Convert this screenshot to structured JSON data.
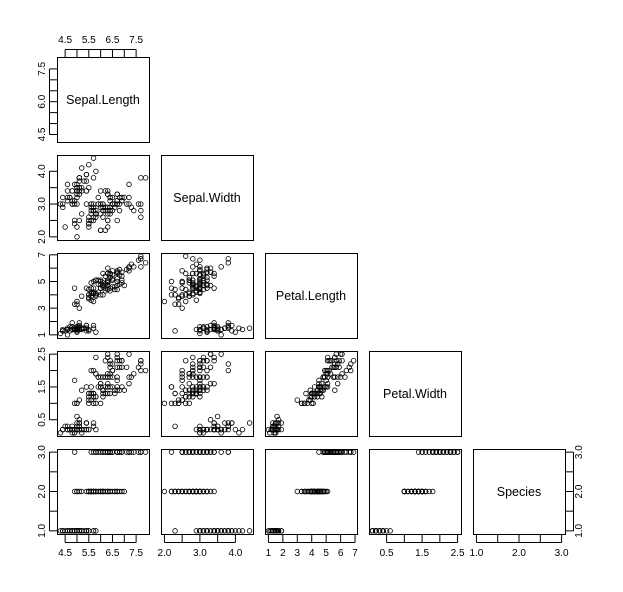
{
  "chart_data": {
    "type": "scatter",
    "title": "",
    "layout": "pairs-lower-triangle",
    "variables": [
      "Sepal.Length",
      "Sepal.Width",
      "Petal.Length",
      "Petal.Width",
      "Species"
    ],
    "ranges": {
      "Sepal.Length": [
        4.3,
        7.9
      ],
      "Sepal.Width": [
        2.0,
        4.4
      ],
      "Petal.Length": [
        1.0,
        6.9
      ],
      "Petal.Width": [
        0.1,
        2.5
      ],
      "Species": [
        1,
        3
      ]
    },
    "ticks": {
      "Sepal.Length": {
        "major": [
          4.5,
          5.0,
          5.5,
          6.0,
          6.5,
          7.0,
          7.5
        ],
        "labels_top": [
          "4.5",
          "5.5",
          "6.5",
          "7.5"
        ],
        "labels_left": [
          "4.5",
          "6.0",
          "7.5"
        ],
        "labels_left_at": [
          4.5,
          6.0,
          7.5
        ],
        "minor_left": [
          4.5,
          5.0,
          5.5,
          6.0,
          6.5,
          7.0,
          7.5
        ]
      },
      "Sepal.Width": {
        "major": [
          2.0,
          2.5,
          3.0,
          3.5,
          4.0
        ],
        "labels": [
          "2.0",
          "3.0",
          "4.0"
        ],
        "labels_at": [
          2.0,
          3.0,
          4.0
        ]
      },
      "Petal.Length": {
        "major": [
          1,
          2,
          3,
          4,
          5,
          6,
          7
        ],
        "labels_bottom": [
          "1",
          "2",
          "3",
          "4",
          "5",
          "6",
          "7"
        ],
        "labels_left": [
          "1",
          "3",
          "5",
          "7"
        ],
        "labels_left_at": [
          1,
          3,
          5,
          7
        ]
      },
      "Petal.Width": {
        "major": [
          0.5,
          1.0,
          1.5,
          2.0,
          2.5
        ],
        "labels": [
          "0.5",
          "1.5",
          "2.5"
        ],
        "labels_at": [
          0.5,
          1.5,
          2.5
        ]
      },
      "Species": {
        "major": [
          1.0,
          1.5,
          2.0,
          2.5,
          3.0
        ],
        "labels": [
          "1.0",
          "2.0",
          "3.0"
        ],
        "labels_at": [
          1.0,
          2.0,
          3.0
        ]
      }
    },
    "marker": "open-circle",
    "columns": [
      "Sepal.Length",
      "Sepal.Width",
      "Petal.Length",
      "Petal.Width",
      "Species"
    ],
    "rows": [
      [
        5.1,
        3.5,
        1.4,
        0.2,
        1
      ],
      [
        4.9,
        3.0,
        1.4,
        0.2,
        1
      ],
      [
        4.7,
        3.2,
        1.3,
        0.2,
        1
      ],
      [
        4.6,
        3.1,
        1.5,
        0.2,
        1
      ],
      [
        5.0,
        3.6,
        1.4,
        0.2,
        1
      ],
      [
        5.4,
        3.9,
        1.7,
        0.4,
        1
      ],
      [
        4.6,
        3.4,
        1.4,
        0.3,
        1
      ],
      [
        5.0,
        3.4,
        1.5,
        0.2,
        1
      ],
      [
        4.4,
        2.9,
        1.4,
        0.2,
        1
      ],
      [
        4.9,
        3.1,
        1.5,
        0.1,
        1
      ],
      [
        5.4,
        3.7,
        1.5,
        0.2,
        1
      ],
      [
        4.8,
        3.4,
        1.6,
        0.2,
        1
      ],
      [
        4.8,
        3.0,
        1.4,
        0.1,
        1
      ],
      [
        4.3,
        3.0,
        1.1,
        0.1,
        1
      ],
      [
        5.8,
        4.0,
        1.2,
        0.2,
        1
      ],
      [
        5.7,
        4.4,
        1.5,
        0.4,
        1
      ],
      [
        5.4,
        3.9,
        1.3,
        0.4,
        1
      ],
      [
        5.1,
        3.5,
        1.4,
        0.3,
        1
      ],
      [
        5.7,
        3.8,
        1.7,
        0.3,
        1
      ],
      [
        5.1,
        3.8,
        1.5,
        0.3,
        1
      ],
      [
        5.4,
        3.4,
        1.7,
        0.2,
        1
      ],
      [
        5.1,
        3.7,
        1.5,
        0.4,
        1
      ],
      [
        4.6,
        3.6,
        1.0,
        0.2,
        1
      ],
      [
        5.1,
        3.3,
        1.7,
        0.5,
        1
      ],
      [
        4.8,
        3.4,
        1.9,
        0.2,
        1
      ],
      [
        5.0,
        3.0,
        1.6,
        0.2,
        1
      ],
      [
        5.0,
        3.4,
        1.6,
        0.4,
        1
      ],
      [
        5.2,
        3.5,
        1.5,
        0.2,
        1
      ],
      [
        5.2,
        3.4,
        1.4,
        0.2,
        1
      ],
      [
        4.7,
        3.2,
        1.6,
        0.2,
        1
      ],
      [
        4.8,
        3.1,
        1.6,
        0.2,
        1
      ],
      [
        5.4,
        3.4,
        1.5,
        0.4,
        1
      ],
      [
        5.2,
        4.1,
        1.5,
        0.1,
        1
      ],
      [
        5.5,
        4.2,
        1.4,
        0.2,
        1
      ],
      [
        4.9,
        3.1,
        1.5,
        0.2,
        1
      ],
      [
        5.0,
        3.2,
        1.2,
        0.2,
        1
      ],
      [
        5.5,
        3.5,
        1.3,
        0.2,
        1
      ],
      [
        4.9,
        3.6,
        1.4,
        0.1,
        1
      ],
      [
        4.4,
        3.0,
        1.3,
        0.2,
        1
      ],
      [
        5.1,
        3.4,
        1.5,
        0.2,
        1
      ],
      [
        5.0,
        3.5,
        1.3,
        0.3,
        1
      ],
      [
        4.5,
        2.3,
        1.3,
        0.3,
        1
      ],
      [
        4.4,
        3.2,
        1.3,
        0.2,
        1
      ],
      [
        5.0,
        3.5,
        1.6,
        0.6,
        1
      ],
      [
        5.1,
        3.8,
        1.9,
        0.4,
        1
      ],
      [
        4.8,
        3.0,
        1.4,
        0.3,
        1
      ],
      [
        5.1,
        3.8,
        1.6,
        0.2,
        1
      ],
      [
        4.6,
        3.2,
        1.4,
        0.2,
        1
      ],
      [
        5.3,
        3.7,
        1.5,
        0.2,
        1
      ],
      [
        5.0,
        3.3,
        1.4,
        0.2,
        1
      ],
      [
        7.0,
        3.2,
        4.7,
        1.4,
        2
      ],
      [
        6.4,
        3.2,
        4.5,
        1.5,
        2
      ],
      [
        6.9,
        3.1,
        4.9,
        1.5,
        2
      ],
      [
        5.5,
        2.3,
        4.0,
        1.3,
        2
      ],
      [
        6.5,
        2.8,
        4.6,
        1.5,
        2
      ],
      [
        5.7,
        2.8,
        4.5,
        1.3,
        2
      ],
      [
        6.3,
        3.3,
        4.7,
        1.6,
        2
      ],
      [
        4.9,
        2.4,
        3.3,
        1.0,
        2
      ],
      [
        6.6,
        2.9,
        4.6,
        1.3,
        2
      ],
      [
        5.2,
        2.7,
        3.9,
        1.4,
        2
      ],
      [
        5.0,
        2.0,
        3.5,
        1.0,
        2
      ],
      [
        5.9,
        3.0,
        4.2,
        1.5,
        2
      ],
      [
        6.0,
        2.2,
        4.0,
        1.0,
        2
      ],
      [
        6.1,
        2.9,
        4.7,
        1.4,
        2
      ],
      [
        5.6,
        2.9,
        3.6,
        1.3,
        2
      ],
      [
        6.7,
        3.1,
        4.4,
        1.4,
        2
      ],
      [
        5.6,
        3.0,
        4.5,
        1.5,
        2
      ],
      [
        5.8,
        2.7,
        4.1,
        1.0,
        2
      ],
      [
        6.2,
        2.2,
        4.5,
        1.5,
        2
      ],
      [
        5.6,
        2.5,
        3.9,
        1.1,
        2
      ],
      [
        5.9,
        3.2,
        4.8,
        1.8,
        2
      ],
      [
        6.1,
        2.8,
        4.0,
        1.3,
        2
      ],
      [
        6.3,
        2.5,
        4.9,
        1.5,
        2
      ],
      [
        6.1,
        2.8,
        4.7,
        1.2,
        2
      ],
      [
        6.4,
        2.9,
        4.3,
        1.3,
        2
      ],
      [
        6.6,
        3.0,
        4.4,
        1.4,
        2
      ],
      [
        6.8,
        2.8,
        4.8,
        1.4,
        2
      ],
      [
        6.7,
        3.0,
        5.0,
        1.7,
        2
      ],
      [
        6.0,
        2.9,
        4.5,
        1.5,
        2
      ],
      [
        5.7,
        2.6,
        3.5,
        1.0,
        2
      ],
      [
        5.5,
        2.4,
        3.8,
        1.1,
        2
      ],
      [
        5.5,
        2.4,
        3.7,
        1.0,
        2
      ],
      [
        5.8,
        2.7,
        3.9,
        1.2,
        2
      ],
      [
        6.0,
        2.7,
        5.1,
        1.6,
        2
      ],
      [
        5.4,
        3.0,
        4.5,
        1.5,
        2
      ],
      [
        6.0,
        3.4,
        4.5,
        1.6,
        2
      ],
      [
        6.7,
        3.1,
        4.7,
        1.5,
        2
      ],
      [
        6.3,
        2.3,
        4.4,
        1.3,
        2
      ],
      [
        5.6,
        3.0,
        4.1,
        1.3,
        2
      ],
      [
        5.5,
        2.5,
        4.0,
        1.3,
        2
      ],
      [
        5.5,
        2.6,
        4.4,
        1.2,
        2
      ],
      [
        6.1,
        3.0,
        4.6,
        1.4,
        2
      ],
      [
        5.8,
        2.6,
        4.0,
        1.2,
        2
      ],
      [
        5.0,
        2.3,
        3.3,
        1.0,
        2
      ],
      [
        5.6,
        2.7,
        4.2,
        1.3,
        2
      ],
      [
        5.7,
        3.0,
        4.2,
        1.2,
        2
      ],
      [
        5.7,
        2.9,
        4.2,
        1.3,
        2
      ],
      [
        6.2,
        2.9,
        4.3,
        1.3,
        2
      ],
      [
        5.1,
        2.5,
        3.0,
        1.1,
        2
      ],
      [
        5.7,
        2.8,
        4.1,
        1.3,
        2
      ],
      [
        6.3,
        3.3,
        6.0,
        2.5,
        3
      ],
      [
        5.8,
        2.7,
        5.1,
        1.9,
        3
      ],
      [
        7.1,
        3.0,
        5.9,
        2.1,
        3
      ],
      [
        6.3,
        2.9,
        5.6,
        1.8,
        3
      ],
      [
        6.5,
        3.0,
        5.8,
        2.2,
        3
      ],
      [
        7.6,
        3.0,
        6.6,
        2.1,
        3
      ],
      [
        4.9,
        2.5,
        4.5,
        1.7,
        3
      ],
      [
        7.3,
        2.9,
        6.3,
        1.8,
        3
      ],
      [
        6.7,
        2.5,
        5.8,
        1.8,
        3
      ],
      [
        7.2,
        3.6,
        6.1,
        2.5,
        3
      ],
      [
        6.5,
        3.2,
        5.1,
        2.0,
        3
      ],
      [
        6.4,
        2.7,
        5.3,
        1.9,
        3
      ],
      [
        6.8,
        3.0,
        5.5,
        2.1,
        3
      ],
      [
        5.7,
        2.5,
        5.0,
        2.0,
        3
      ],
      [
        5.8,
        2.8,
        5.1,
        2.4,
        3
      ],
      [
        6.4,
        3.2,
        5.3,
        2.3,
        3
      ],
      [
        6.5,
        3.0,
        5.5,
        1.8,
        3
      ],
      [
        7.7,
        3.8,
        6.7,
        2.2,
        3
      ],
      [
        7.7,
        2.6,
        6.9,
        2.3,
        3
      ],
      [
        6.0,
        2.2,
        5.0,
        1.5,
        3
      ],
      [
        6.9,
        3.2,
        5.7,
        2.3,
        3
      ],
      [
        5.6,
        2.8,
        4.9,
        2.0,
        3
      ],
      [
        7.7,
        2.8,
        6.7,
        2.0,
        3
      ],
      [
        6.3,
        2.7,
        4.9,
        1.8,
        3
      ],
      [
        6.7,
        3.3,
        5.7,
        2.1,
        3
      ],
      [
        7.2,
        3.2,
        6.0,
        1.8,
        3
      ],
      [
        6.2,
        2.8,
        4.8,
        1.8,
        3
      ],
      [
        6.1,
        3.0,
        4.9,
        1.8,
        3
      ],
      [
        6.4,
        2.8,
        5.6,
        2.1,
        3
      ],
      [
        7.2,
        3.0,
        5.8,
        1.6,
        3
      ],
      [
        7.4,
        2.8,
        6.1,
        1.9,
        3
      ],
      [
        7.9,
        3.8,
        6.4,
        2.0,
        3
      ],
      [
        6.4,
        2.8,
        5.6,
        2.2,
        3
      ],
      [
        6.3,
        2.8,
        5.1,
        1.5,
        3
      ],
      [
        6.1,
        2.6,
        5.6,
        1.4,
        3
      ],
      [
        7.7,
        3.0,
        6.1,
        2.3,
        3
      ],
      [
        6.3,
        3.4,
        5.6,
        2.4,
        3
      ],
      [
        6.4,
        3.1,
        5.5,
        1.8,
        3
      ],
      [
        6.0,
        3.0,
        4.8,
        1.8,
        3
      ],
      [
        6.9,
        3.1,
        5.4,
        2.1,
        3
      ],
      [
        6.7,
        3.1,
        5.6,
        2.4,
        3
      ],
      [
        6.9,
        3.1,
        5.1,
        2.3,
        3
      ],
      [
        5.8,
        2.7,
        5.1,
        1.9,
        3
      ],
      [
        6.8,
        3.2,
        5.9,
        2.3,
        3
      ],
      [
        6.7,
        3.3,
        5.7,
        2.5,
        3
      ],
      [
        6.7,
        3.0,
        5.2,
        2.3,
        3
      ],
      [
        6.3,
        2.5,
        5.0,
        1.9,
        3
      ],
      [
        6.5,
        3.0,
        5.2,
        2.0,
        3
      ],
      [
        6.2,
        3.4,
        5.4,
        2.3,
        3
      ],
      [
        5.9,
        3.0,
        5.1,
        1.8,
        3
      ]
    ]
  }
}
